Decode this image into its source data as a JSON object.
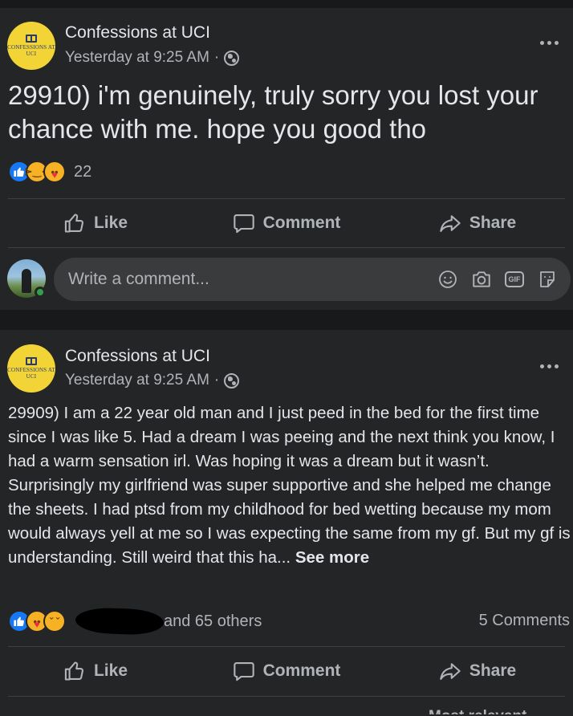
{
  "posts": [
    {
      "page_name": "Confessions at UCI",
      "avatar_text": "CONFESSIONS AT UCI",
      "timestamp": "Yesterday at 9:25 AM",
      "separator": "·",
      "body": "29910) i'm genuinely, truly sorry you lost your chance with me. hope you good tho",
      "reactions": [
        "like",
        "haha",
        "care"
      ],
      "reaction_count": "22",
      "actions": {
        "like": "Like",
        "comment": "Comment",
        "share": "Share"
      },
      "comment_placeholder": "Write a comment..."
    },
    {
      "page_name": "Confessions at UCI",
      "avatar_text": "CONFESSIONS AT UCI",
      "timestamp": "Yesterday at 9:25 AM",
      "separator": "·",
      "body": "29909) I am a 22 year old man and I just peed in the bed for the first time since I was like 5. Had a dream I was peeing and the next think you know, I had a warm sensation irl. Was hoping it was a dream but it wasn’t. Surprisingly my girlfriend was super supportive and she helped me change the sheets. I had ptsd from my childhood for bed wetting because my mom would always yell at me so I was expecting the same from my gf. But my gf is understanding. Still weird that this ha...",
      "see_more": "See more",
      "reactions": [
        "like",
        "care",
        "sad"
      ],
      "reaction_others": "and 65 others",
      "comments_count": "5 Comments",
      "actions": {
        "like": "Like",
        "comment": "Comment",
        "share": "Share"
      },
      "sort_label": "Most relevant"
    }
  ],
  "colors": {
    "background": "#18191a",
    "card": "#242526",
    "like_blue": "#1877f2",
    "online_green": "#31a24c"
  }
}
